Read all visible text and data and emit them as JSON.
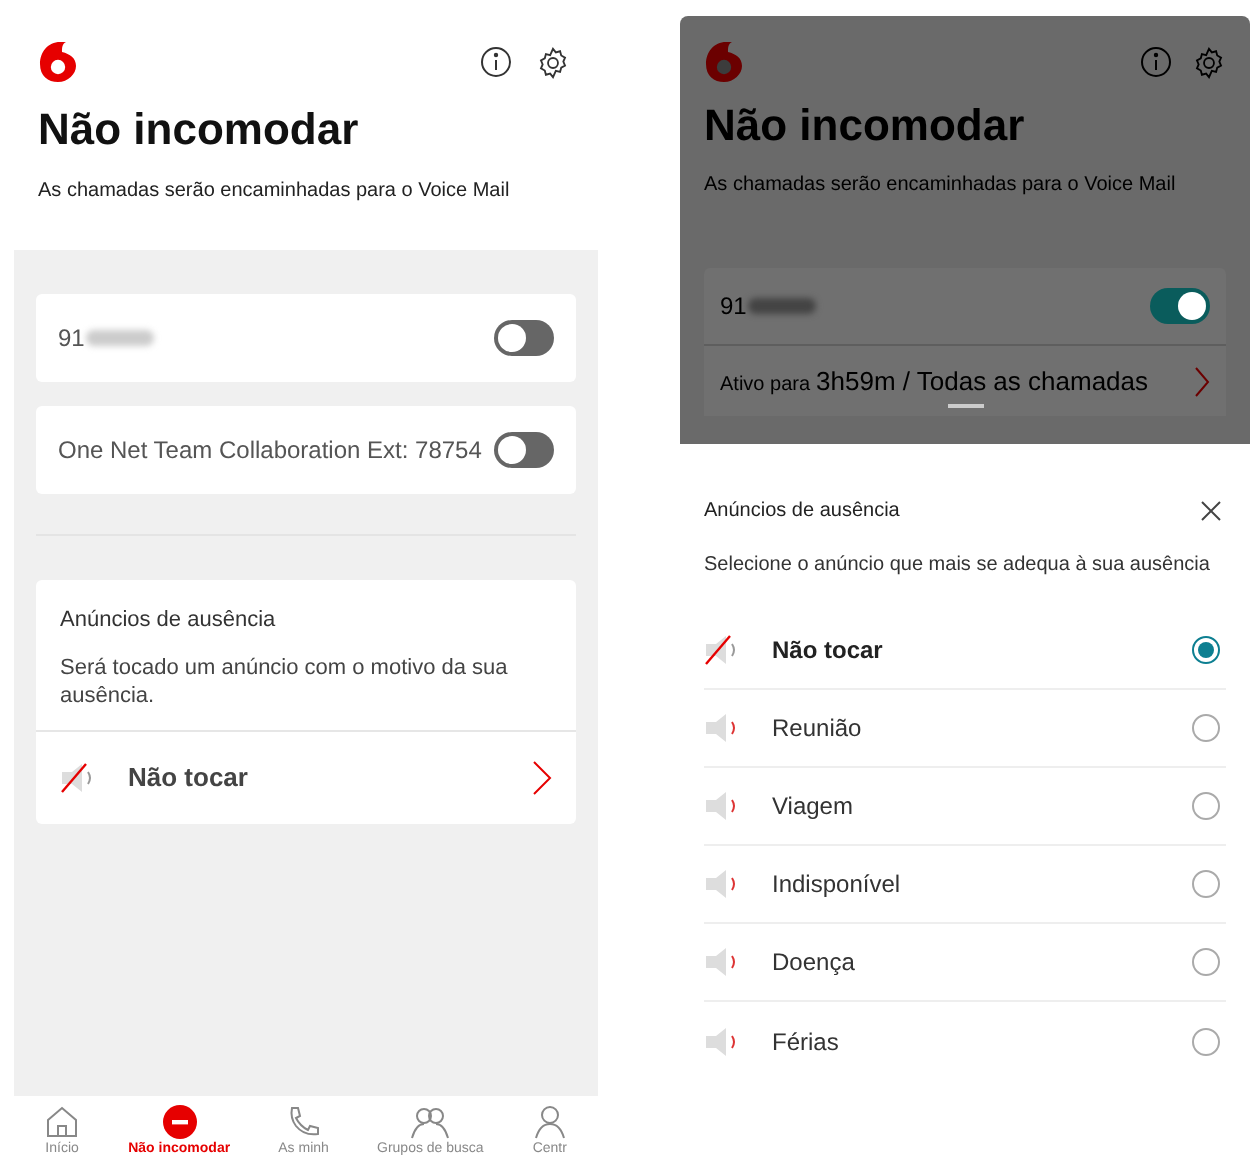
{
  "main": {
    "title": "Não incomodar",
    "subtitle": "As chamadas serão encaminhadas para o Voice Mail",
    "lines": [
      {
        "label": "91",
        "blurred": true,
        "on": false
      },
      {
        "label": "One Net Team Collaboration Ext: 78754",
        "blurred": false,
        "on": false
      }
    ],
    "announcements": {
      "title": "Anúncios de ausência",
      "description": "Será tocado um anúncio com o motivo da sua ausência.",
      "current": "Não tocar"
    },
    "nav": [
      {
        "label": "Início",
        "selected": false,
        "kind": "home"
      },
      {
        "label": "Não incomodar",
        "selected": true,
        "kind": "dnd"
      },
      {
        "label": "As minh",
        "selected": false,
        "kind": "phone"
      },
      {
        "label": "Grupos de busca",
        "selected": false,
        "kind": "group"
      },
      {
        "label": "Centr",
        "selected": false,
        "kind": "person"
      }
    ]
  },
  "background": {
    "title": "Não incomodar",
    "subtitle": "As chamadas serão encaminhadas para o Voice Mail",
    "line": {
      "label": "91",
      "blurred": true,
      "on": true
    },
    "status_prefix": "Ativo para",
    "status": "3h59m / Todas as chamadas"
  },
  "sheet": {
    "title": "Anúncios de ausência",
    "description": "Selecione o anúncio que mais se adequa à sua ausência",
    "options": [
      {
        "label": "Não tocar",
        "kind": "muted",
        "selected": true
      },
      {
        "label": "Reunião",
        "kind": "sound",
        "selected": false
      },
      {
        "label": "Viagem",
        "kind": "sound",
        "selected": false
      },
      {
        "label": "Indisponível",
        "kind": "sound",
        "selected": false
      },
      {
        "label": "Doença",
        "kind": "sound",
        "selected": false
      },
      {
        "label": "Férias",
        "kind": "sound",
        "selected": false
      }
    ]
  }
}
